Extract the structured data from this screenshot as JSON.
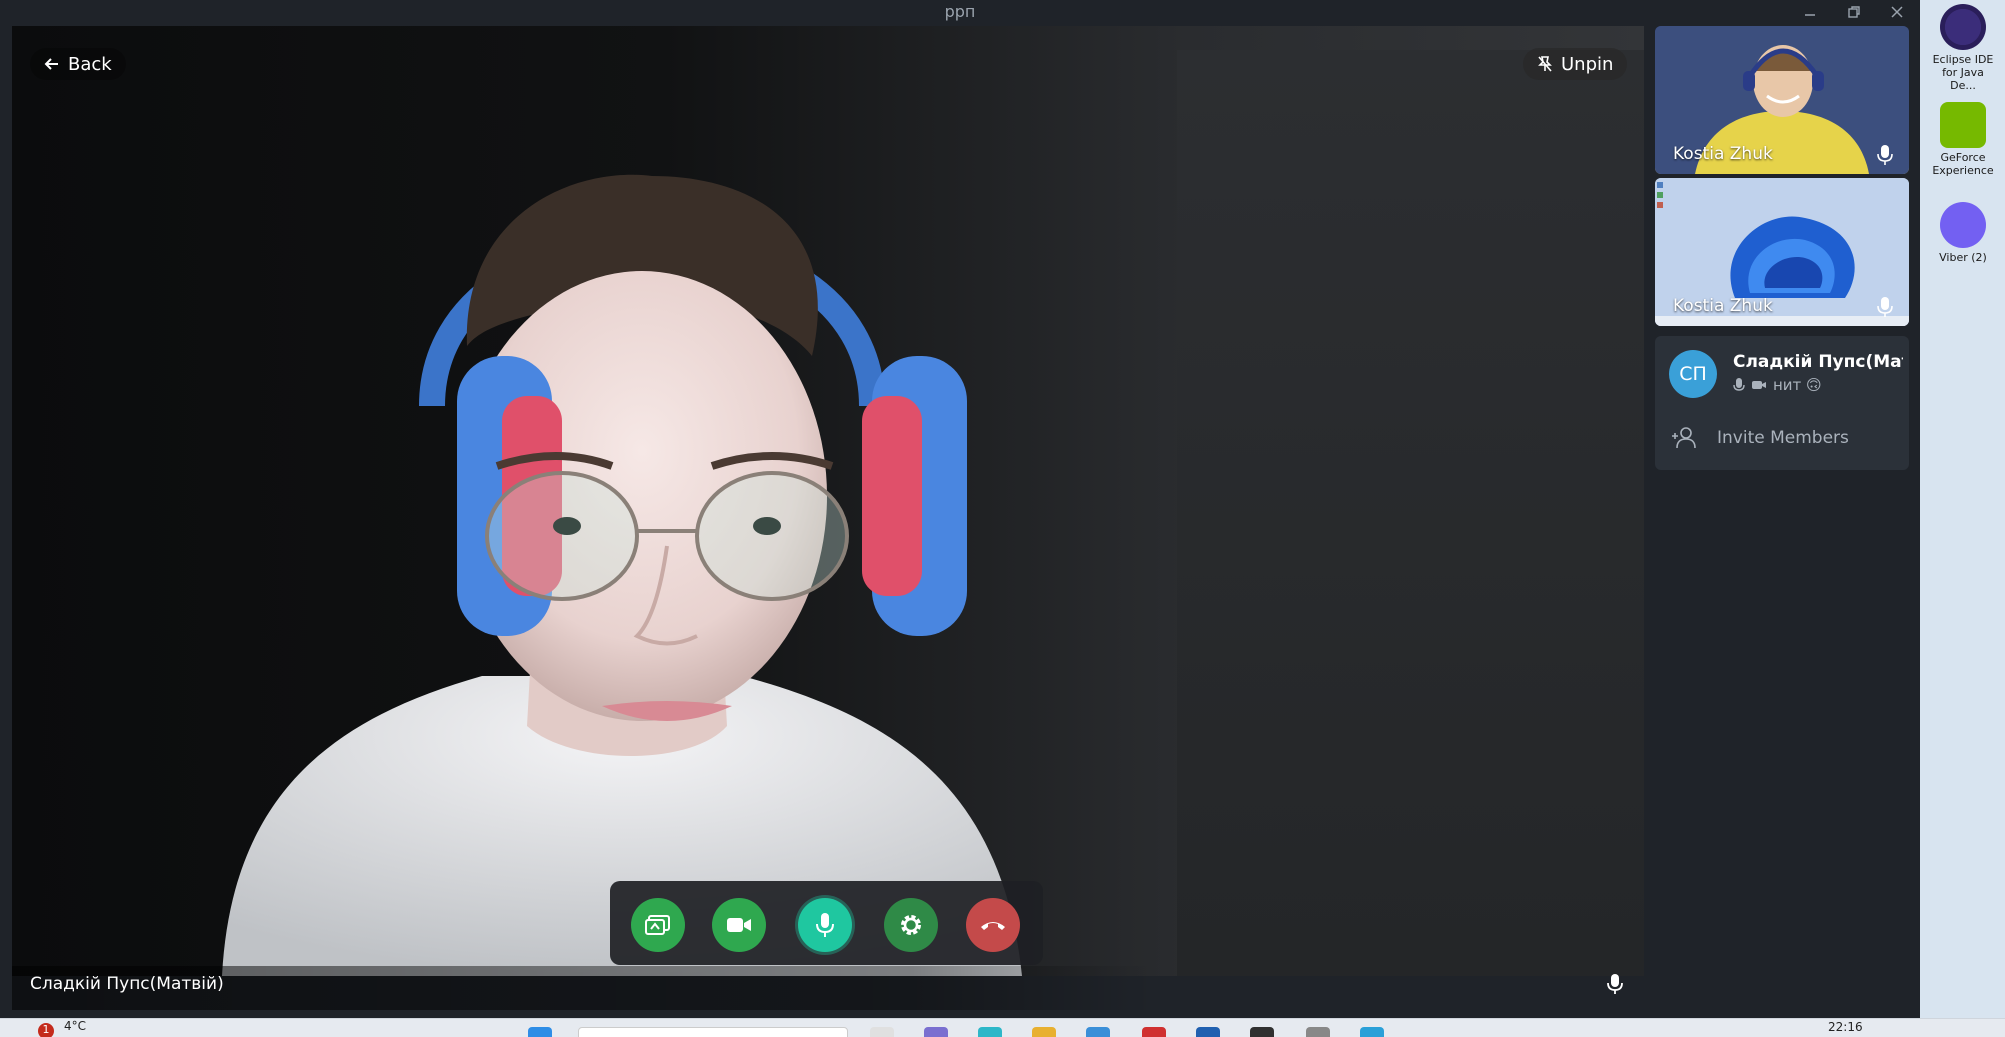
{
  "window": {
    "title": "рpп"
  },
  "main": {
    "back_label": "Back",
    "unpin_label": "Unpin",
    "speaker_name": "Сладкій Пупс(Матвій)"
  },
  "controls": {
    "buttons": [
      "screen-share",
      "camera",
      "microphone",
      "settings",
      "end-call"
    ],
    "colors": {
      "green": "#2fa84f",
      "mic_active": "#1fc7a0",
      "settings": "#2f8a47",
      "end": "#c44a4a"
    }
  },
  "sidebar": {
    "tiles": [
      {
        "name": "Kostia Zhuk"
      },
      {
        "name": "Kostia Zhuk"
      }
    ],
    "member": {
      "initials": "СП",
      "name": "Сладкій Пупс(Мат...",
      "status": "нит 🙃"
    },
    "invite_label": "Invite Members"
  },
  "desktop": {
    "icons": [
      {
        "label": "Eclipse IDE for Java De..."
      },
      {
        "label": "GeForce Experience"
      },
      {
        "label": "Viber (2)"
      }
    ]
  },
  "taskbar": {
    "weather": "4°C",
    "badge": "1",
    "time": "22:16"
  }
}
